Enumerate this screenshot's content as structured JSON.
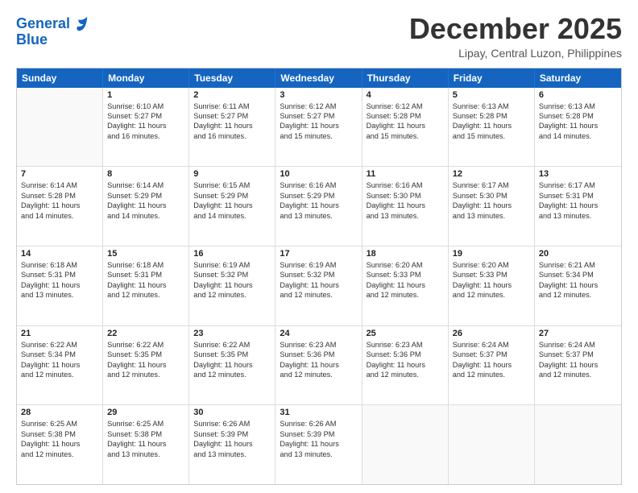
{
  "logo": {
    "line1": "General",
    "line2": "Blue"
  },
  "title": "December 2025",
  "location": "Lipay, Central Luzon, Philippines",
  "days_of_week": [
    "Sunday",
    "Monday",
    "Tuesday",
    "Wednesday",
    "Thursday",
    "Friday",
    "Saturday"
  ],
  "weeks": [
    [
      {
        "day": "",
        "lines": []
      },
      {
        "day": "1",
        "lines": [
          "Sunrise: 6:10 AM",
          "Sunset: 5:27 PM",
          "Daylight: 11 hours",
          "and 16 minutes."
        ]
      },
      {
        "day": "2",
        "lines": [
          "Sunrise: 6:11 AM",
          "Sunset: 5:27 PM",
          "Daylight: 11 hours",
          "and 16 minutes."
        ]
      },
      {
        "day": "3",
        "lines": [
          "Sunrise: 6:12 AM",
          "Sunset: 5:27 PM",
          "Daylight: 11 hours",
          "and 15 minutes."
        ]
      },
      {
        "day": "4",
        "lines": [
          "Sunrise: 6:12 AM",
          "Sunset: 5:28 PM",
          "Daylight: 11 hours",
          "and 15 minutes."
        ]
      },
      {
        "day": "5",
        "lines": [
          "Sunrise: 6:13 AM",
          "Sunset: 5:28 PM",
          "Daylight: 11 hours",
          "and 15 minutes."
        ]
      },
      {
        "day": "6",
        "lines": [
          "Sunrise: 6:13 AM",
          "Sunset: 5:28 PM",
          "Daylight: 11 hours",
          "and 14 minutes."
        ]
      }
    ],
    [
      {
        "day": "7",
        "lines": [
          "Sunrise: 6:14 AM",
          "Sunset: 5:28 PM",
          "Daylight: 11 hours",
          "and 14 minutes."
        ]
      },
      {
        "day": "8",
        "lines": [
          "Sunrise: 6:14 AM",
          "Sunset: 5:29 PM",
          "Daylight: 11 hours",
          "and 14 minutes."
        ]
      },
      {
        "day": "9",
        "lines": [
          "Sunrise: 6:15 AM",
          "Sunset: 5:29 PM",
          "Daylight: 11 hours",
          "and 14 minutes."
        ]
      },
      {
        "day": "10",
        "lines": [
          "Sunrise: 6:16 AM",
          "Sunset: 5:29 PM",
          "Daylight: 11 hours",
          "and 13 minutes."
        ]
      },
      {
        "day": "11",
        "lines": [
          "Sunrise: 6:16 AM",
          "Sunset: 5:30 PM",
          "Daylight: 11 hours",
          "and 13 minutes."
        ]
      },
      {
        "day": "12",
        "lines": [
          "Sunrise: 6:17 AM",
          "Sunset: 5:30 PM",
          "Daylight: 11 hours",
          "and 13 minutes."
        ]
      },
      {
        "day": "13",
        "lines": [
          "Sunrise: 6:17 AM",
          "Sunset: 5:31 PM",
          "Daylight: 11 hours",
          "and 13 minutes."
        ]
      }
    ],
    [
      {
        "day": "14",
        "lines": [
          "Sunrise: 6:18 AM",
          "Sunset: 5:31 PM",
          "Daylight: 11 hours",
          "and 13 minutes."
        ]
      },
      {
        "day": "15",
        "lines": [
          "Sunrise: 6:18 AM",
          "Sunset: 5:31 PM",
          "Daylight: 11 hours",
          "and 12 minutes."
        ]
      },
      {
        "day": "16",
        "lines": [
          "Sunrise: 6:19 AM",
          "Sunset: 5:32 PM",
          "Daylight: 11 hours",
          "and 12 minutes."
        ]
      },
      {
        "day": "17",
        "lines": [
          "Sunrise: 6:19 AM",
          "Sunset: 5:32 PM",
          "Daylight: 11 hours",
          "and 12 minutes."
        ]
      },
      {
        "day": "18",
        "lines": [
          "Sunrise: 6:20 AM",
          "Sunset: 5:33 PM",
          "Daylight: 11 hours",
          "and 12 minutes."
        ]
      },
      {
        "day": "19",
        "lines": [
          "Sunrise: 6:20 AM",
          "Sunset: 5:33 PM",
          "Daylight: 11 hours",
          "and 12 minutes."
        ]
      },
      {
        "day": "20",
        "lines": [
          "Sunrise: 6:21 AM",
          "Sunset: 5:34 PM",
          "Daylight: 11 hours",
          "and 12 minutes."
        ]
      }
    ],
    [
      {
        "day": "21",
        "lines": [
          "Sunrise: 6:22 AM",
          "Sunset: 5:34 PM",
          "Daylight: 11 hours",
          "and 12 minutes."
        ]
      },
      {
        "day": "22",
        "lines": [
          "Sunrise: 6:22 AM",
          "Sunset: 5:35 PM",
          "Daylight: 11 hours",
          "and 12 minutes."
        ]
      },
      {
        "day": "23",
        "lines": [
          "Sunrise: 6:22 AM",
          "Sunset: 5:35 PM",
          "Daylight: 11 hours",
          "and 12 minutes."
        ]
      },
      {
        "day": "24",
        "lines": [
          "Sunrise: 6:23 AM",
          "Sunset: 5:36 PM",
          "Daylight: 11 hours",
          "and 12 minutes."
        ]
      },
      {
        "day": "25",
        "lines": [
          "Sunrise: 6:23 AM",
          "Sunset: 5:36 PM",
          "Daylight: 11 hours",
          "and 12 minutes."
        ]
      },
      {
        "day": "26",
        "lines": [
          "Sunrise: 6:24 AM",
          "Sunset: 5:37 PM",
          "Daylight: 11 hours",
          "and 12 minutes."
        ]
      },
      {
        "day": "27",
        "lines": [
          "Sunrise: 6:24 AM",
          "Sunset: 5:37 PM",
          "Daylight: 11 hours",
          "and 12 minutes."
        ]
      }
    ],
    [
      {
        "day": "28",
        "lines": [
          "Sunrise: 6:25 AM",
          "Sunset: 5:38 PM",
          "Daylight: 11 hours",
          "and 12 minutes."
        ]
      },
      {
        "day": "29",
        "lines": [
          "Sunrise: 6:25 AM",
          "Sunset: 5:38 PM",
          "Daylight: 11 hours",
          "and 13 minutes."
        ]
      },
      {
        "day": "30",
        "lines": [
          "Sunrise: 6:26 AM",
          "Sunset: 5:39 PM",
          "Daylight: 11 hours",
          "and 13 minutes."
        ]
      },
      {
        "day": "31",
        "lines": [
          "Sunrise: 6:26 AM",
          "Sunset: 5:39 PM",
          "Daylight: 11 hours",
          "and 13 minutes."
        ]
      },
      {
        "day": "",
        "lines": []
      },
      {
        "day": "",
        "lines": []
      },
      {
        "day": "",
        "lines": []
      }
    ]
  ]
}
